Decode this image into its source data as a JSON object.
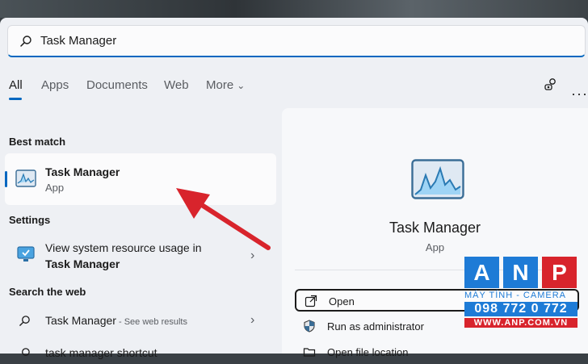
{
  "search": {
    "query": "Task Manager"
  },
  "tabs": [
    {
      "label": "All",
      "active": true
    },
    {
      "label": "Apps"
    },
    {
      "label": "Documents"
    },
    {
      "label": "Web"
    },
    {
      "label": "More"
    }
  ],
  "toolbar": {
    "account_icon": "people-search-icon",
    "more_icon": "ellipsis-icon",
    "more_glyph": "···"
  },
  "best_match": {
    "heading": "Best match",
    "name": "Task Manager",
    "type": "App",
    "icon": "task-manager-icon"
  },
  "settings": {
    "heading": "Settings",
    "line1": "View system resource usage in",
    "line2": "Task Manager",
    "icon": "monitor-check-icon"
  },
  "web": {
    "heading": "Search the web",
    "items": [
      {
        "text": "Task Manager",
        "suffix": " - See web results"
      },
      {
        "text": "task manager shortcut"
      }
    ]
  },
  "detail": {
    "title": "Task Manager",
    "type": "App",
    "actions": [
      {
        "label": "Open",
        "icon": "open-external-icon"
      },
      {
        "label": "Run as administrator",
        "icon": "shield-icon"
      },
      {
        "label": "Open file location",
        "icon": "folder-icon"
      }
    ]
  },
  "watermark": {
    "letters": [
      "A",
      "N",
      "P"
    ],
    "tagline": "MÁY TÍNH - CAMERA",
    "phone": "098 772 0 772",
    "website": "WWW.ANP.COM.VN"
  },
  "colors": {
    "accent": "#0067c0",
    "arrow": "#d8242c",
    "anp_blue": "#1e7bd6",
    "anp_red": "#d8242c"
  }
}
